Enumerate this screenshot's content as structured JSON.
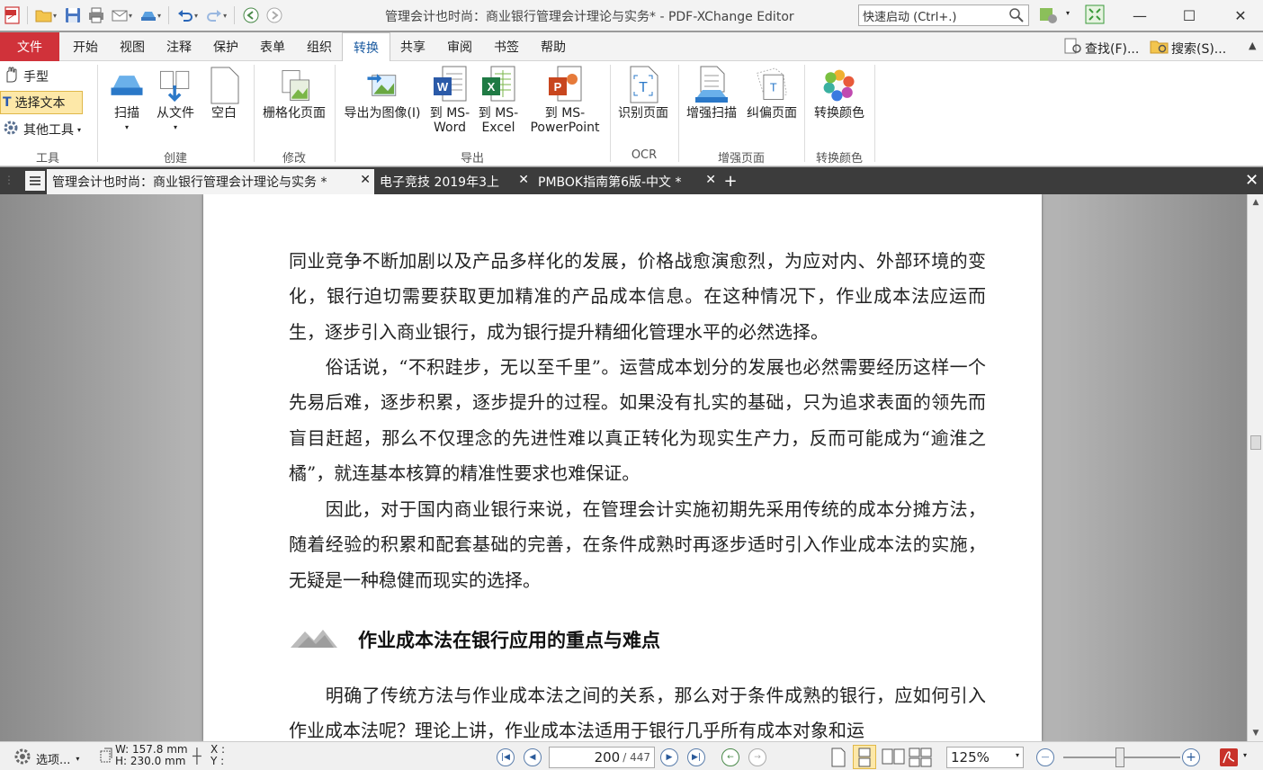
{
  "app": {
    "title": "管理会计也时尚：商业银行管理会计理论与实务* - PDF-XChange Editor",
    "quick_launch_placeholder": "快速启动 (Ctrl+.)"
  },
  "menu": {
    "file": "文件",
    "tabs": [
      "开始",
      "视图",
      "注释",
      "保护",
      "表单",
      "组织",
      "转换",
      "共享",
      "审阅",
      "书签",
      "帮助"
    ],
    "active_tab": "转换",
    "find": "查找(F)...",
    "search": "搜索(S)..."
  },
  "ribbon": {
    "tools": {
      "hand": "手型",
      "select_text": "选择文本",
      "other_tools": "其他工具",
      "group": "工具"
    },
    "create": {
      "scan": "扫描",
      "from_file": "从文件",
      "blank": "空白",
      "group": "创建"
    },
    "modify": {
      "rasterize": "栅格化页面",
      "group": "修改"
    },
    "export": {
      "to_image": "导出为图像(I)",
      "to_word_1": "到 MS-",
      "to_word_2": "Word",
      "to_excel_1": "到 MS-",
      "to_excel_2": "Excel",
      "to_ppt_1": "到 MS-",
      "to_ppt_2": "PowerPoint",
      "group": "导出"
    },
    "ocr": {
      "recognize": "识别页面",
      "group": "OCR"
    },
    "enhance": {
      "enhance_scan": "增强扫描",
      "deskew": "纠偏页面",
      "group": "增强页面"
    },
    "convert_colors": {
      "label": "转换颜色",
      "group": "转换颜色"
    }
  },
  "doc_tabs": [
    {
      "label": "管理会计也时尚：商业银行管理会计理论与实务 *",
      "active": true
    },
    {
      "label": "电子竞技 2019年3上",
      "active": false
    },
    {
      "label": "PMBOK指南第6版-中文 *",
      "active": false
    }
  ],
  "document": {
    "para1": "同业竞争不断加剧以及产品多样化的发展，价格战愈演愈烈，为应对内、外部环境的变化，银行迫切需要获取更加精准的产品成本信息。在这种情况下，作业成本法应运而生，逐步引入商业银行，成为银行提升精细化管理水平的必然选择。",
    "para2": "　　俗话说，“不积跬步，无以至千里”。运营成本划分的发展也必然需要经历这样一个先易后难，逐步积累，逐步提升的过程。如果没有扎实的基础，只为追求表面的领先而盲目赶超，那么不仅理念的先进性难以真正转化为现实生产力，反而可能成为“逾淮之橘”，就连基本核算的精准性要求也难保证。",
    "para3": "　　因此，对于国内商业银行来说，在管理会计实施初期先采用传统的成本分摊方法，随着经验的积累和配套基础的完善，在条件成熟时再逐步适时引入作业成本法的实施，无疑是一种稳健而现实的选择。",
    "heading": "作业成本法在银行应用的重点与难点",
    "para4": "　　明确了传统方法与作业成本法之间的关系，那么对于条件成熟的银行，应如何引入作业成本法呢？理论上讲，作业成本法适用于银行几乎所有成本对象和运"
  },
  "status": {
    "options": "选项...",
    "width": "W: 157.8 mm",
    "height": "H: 230.0 mm",
    "x": "X :",
    "y": "Y :",
    "current_page": "200",
    "total_pages": "/ 447",
    "zoom": "125%"
  },
  "colors": {
    "file_tab": "#d0323a",
    "tab_bar": "#3c3c3c"
  }
}
